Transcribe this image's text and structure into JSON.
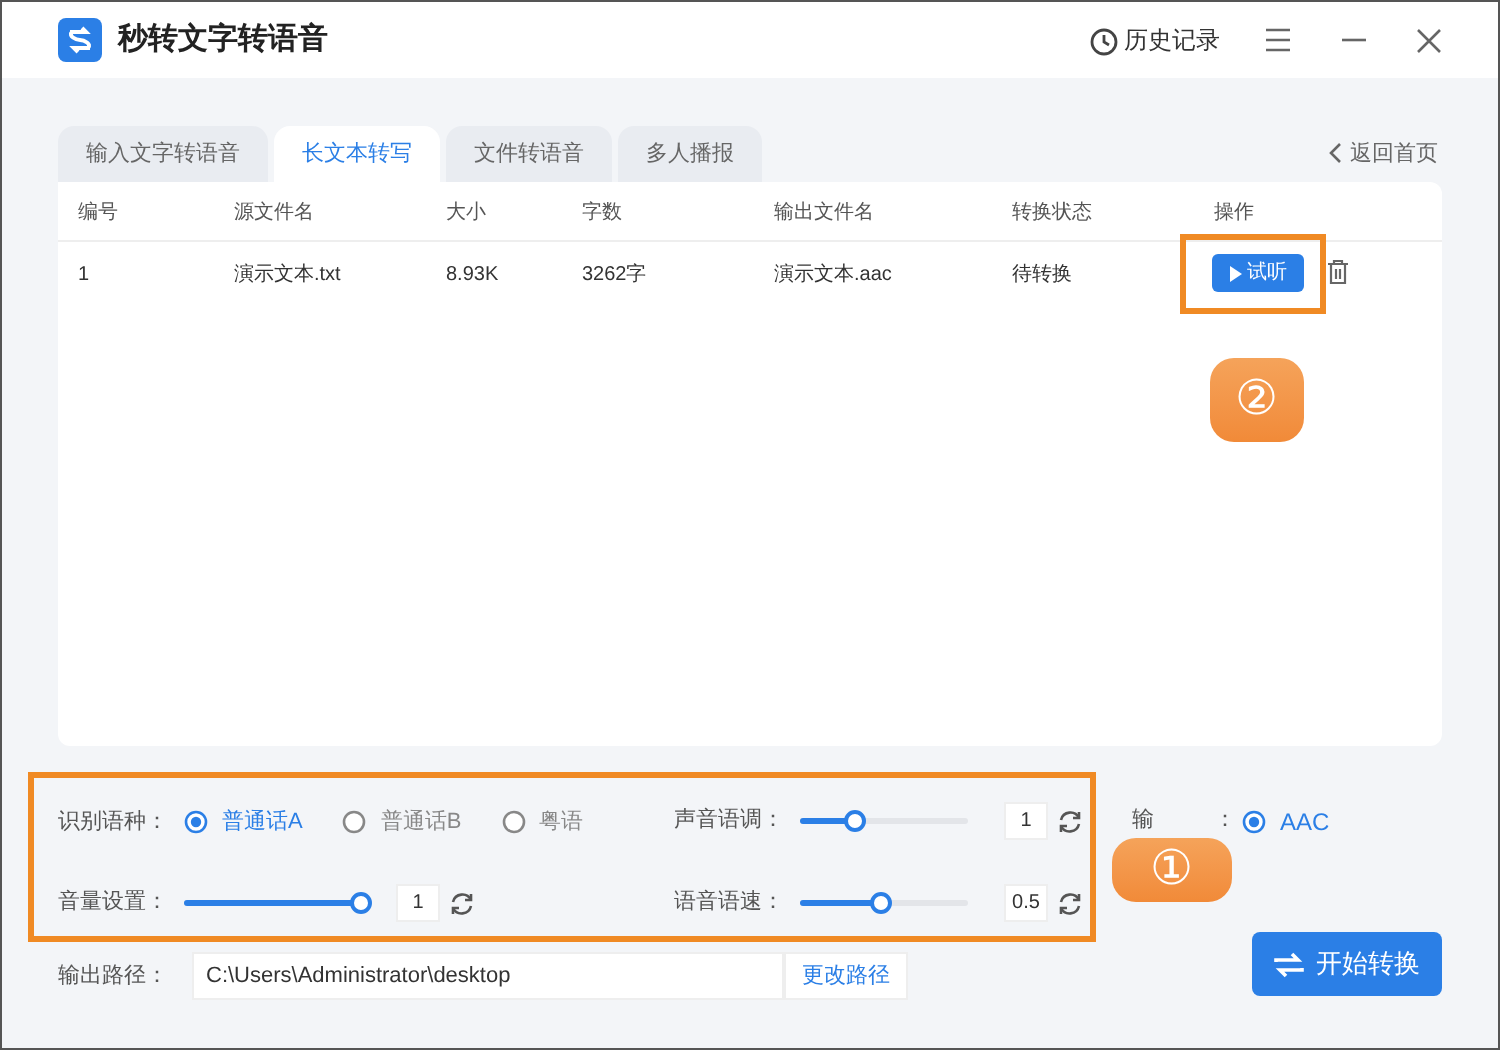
{
  "window": {
    "title": "秒转文字转语音",
    "history": "历史记录"
  },
  "tabs": [
    {
      "label": "输入文字转语音",
      "selected": false
    },
    {
      "label": "长文本转写",
      "selected": true
    },
    {
      "label": "文件转语音",
      "selected": false
    },
    {
      "label": "多人播报",
      "selected": false
    }
  ],
  "back_link": "返回首页",
  "table": {
    "columns": [
      "编号",
      "源文件名",
      "大小",
      "字数",
      "输出文件名",
      "转换状态",
      "操作"
    ],
    "rows": [
      {
        "cells": [
          "1",
          "演示文本.txt",
          "8.93K",
          "3262字",
          "演示文本.aac",
          "待转换"
        ],
        "play_button": "试听"
      }
    ]
  },
  "settings": {
    "language_label": "识别语种：",
    "languages": [
      {
        "label": "普通话A",
        "selected": true
      },
      {
        "label": "普通话B",
        "selected": false
      },
      {
        "label": "粤语",
        "selected": false
      }
    ],
    "volume": {
      "label": "音量设置：",
      "level": 1,
      "value": "1"
    },
    "pitch": {
      "label": "声音语调：",
      "level": 0.33,
      "value": "1"
    },
    "speed": {
      "label": "语音语速：",
      "level": 0.48,
      "value": "0.5"
    }
  },
  "format": {
    "label_start": "输",
    "label_end": "：",
    "options": [
      {
        "label": "AAC",
        "selected": true
      }
    ]
  },
  "output_path": {
    "label": "输出路径：",
    "value": "C:\\Users\\Administrator\\desktop",
    "change_button": "更改路径"
  },
  "start_button": "开始转换",
  "callouts": [
    "①",
    "②"
  ]
}
